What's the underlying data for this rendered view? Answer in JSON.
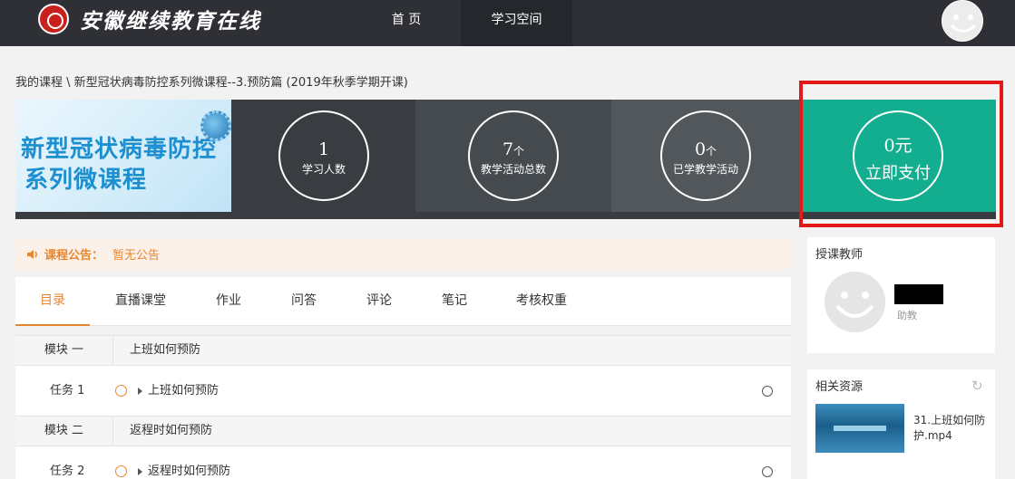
{
  "header": {
    "logo_text": "安徽继续教育在线",
    "nav": [
      {
        "label": "首 页"
      },
      {
        "label": "学习空间"
      }
    ]
  },
  "breadcrumb": "我的课程 \\ 新型冠状病毒防控系列微课程--3.预防篇 (2019年秋季学期开课)",
  "banner": {
    "image_title_line1": "新型冠状病毒防控",
    "image_title_line2": "系列微课程",
    "stats": [
      {
        "value": "1",
        "unit": "",
        "label": "学习人数"
      },
      {
        "value": "7",
        "unit": "个",
        "label": "教学活动总数"
      },
      {
        "value": "0",
        "unit": "个",
        "label": "已学教学活动"
      }
    ],
    "pay": {
      "amount": "0元",
      "label": "立即支付"
    }
  },
  "notice": {
    "label": "课程公告：",
    "text": "暂无公告"
  },
  "tabs": [
    "目录",
    "直播课堂",
    "作业",
    "问答",
    "评论",
    "笔记",
    "考核权重"
  ],
  "modules": [
    {
      "tag": "模块 一",
      "title": "上班如何预防",
      "task": {
        "tag": "任务 1",
        "title": "上班如何预防"
      }
    },
    {
      "tag": "模块 二",
      "title": "返程时如何预防",
      "task": {
        "tag": "任务 2",
        "title": "返程时如何预防"
      }
    }
  ],
  "teacher_panel": {
    "title": "授课教师",
    "name": "____",
    "role": "助教"
  },
  "resource_panel": {
    "title": "相关资源",
    "item_name": "31.上班如何防护.mp4"
  },
  "colors": {
    "accent": "#e7862e",
    "pay": "#13ae8f",
    "highlight_frame": "#e31818",
    "topbar": "#2e3035"
  },
  "icons": [
    "speaker-icon",
    "refresh-icon",
    "smiley-avatar-icon",
    "status-circle-icon",
    "caret-right-icon"
  ]
}
